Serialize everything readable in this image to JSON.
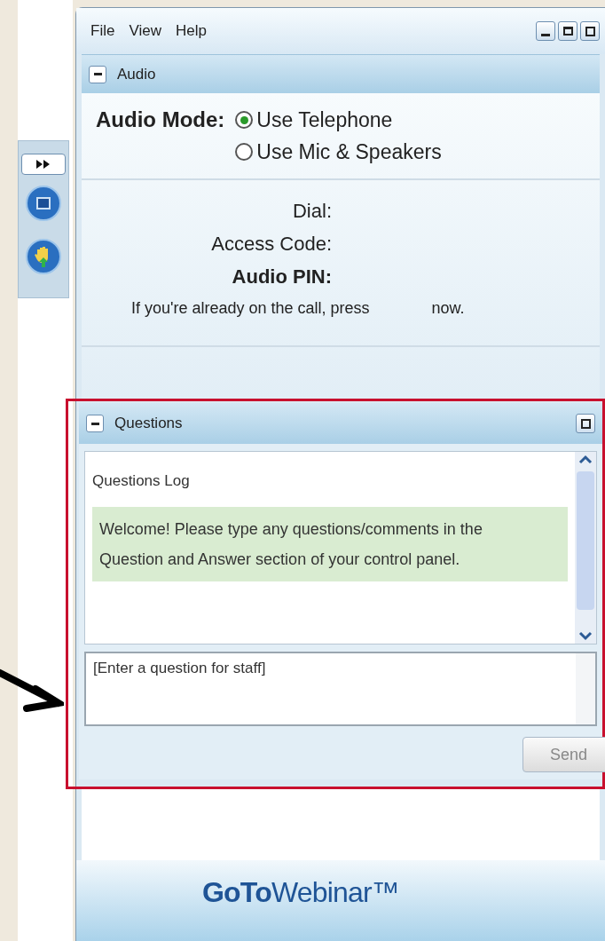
{
  "menu": [
    "File",
    "View",
    "Help"
  ],
  "audio": {
    "title": "Audio",
    "mode_label": "Audio Mode:",
    "options": [
      {
        "label": "Use Telephone",
        "selected": true
      },
      {
        "label": "Use Mic & Speakers",
        "selected": false
      }
    ],
    "fields": [
      {
        "label": "Dial:",
        "bold": false
      },
      {
        "label": "Access Code:",
        "bold": false
      },
      {
        "label": "Audio PIN:",
        "bold": true
      }
    ],
    "note": "If you're already on the call, press",
    "note_end": "now."
  },
  "questions": {
    "title": "Questions",
    "log_title": "Questions Log",
    "messages": [
      "Welcome! Please type any questions/comments in the Question and Answer section of your control panel."
    ],
    "input_placeholder": "[Enter a question for staff]",
    "send": "Send"
  },
  "logo": "**GoTo**Webinar™"
}
